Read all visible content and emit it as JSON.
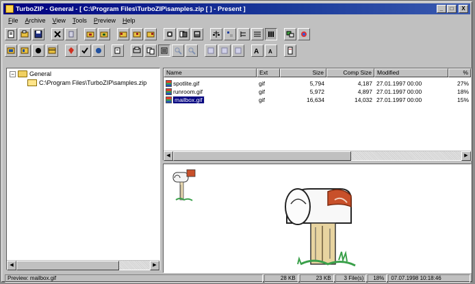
{
  "window": {
    "title": "TurboZIP - General - [ C:\\Program Files\\TurboZIP\\samples.zip [  ] - Present ]",
    "controls": [
      "_",
      "□",
      "X"
    ]
  },
  "menu": [
    {
      "u": "F",
      "rest": "ile"
    },
    {
      "u": "A",
      "rest": "rchive"
    },
    {
      "u": "V",
      "rest": "iew"
    },
    {
      "u": "T",
      "rest": "ools"
    },
    {
      "u": "P",
      "rest": "review"
    },
    {
      "u": "H",
      "rest": "elp"
    }
  ],
  "toolbar_icons": {
    "row1": [
      "new-icon",
      "open-icon",
      "save-icon",
      "delete-icon",
      "cut-icon",
      "add-icon",
      "extract-icon",
      "folder-view-icon",
      "folder-open-icon",
      "folder-close-icon",
      "view-icon",
      "zoom-icon",
      "print-icon",
      "scales-icon",
      "sort-icon",
      "tree-view-icon",
      "details-view-icon",
      "list-view-icon",
      "filter-icon",
      "options-icon"
    ],
    "row2": [
      "window-icon",
      "find-icon",
      "record-icon",
      "calendar-icon",
      "tag-icon",
      "check-icon",
      "test-icon",
      "copy-icon",
      "print-preview-icon",
      "preview-toggle-icon",
      "fit-icon",
      "zoom-in-icon",
      "zoom-out-icon",
      "tile-icon",
      "cascade-icon",
      "font-larger-icon",
      "font-smaller-icon",
      "settings-icon"
    ]
  },
  "tree": {
    "root": "General",
    "child": "C:\\Program Files\\TurboZIP\\samples.zip"
  },
  "list": {
    "columns": [
      "Name",
      "Ext",
      "Size",
      "Comp Size",
      "Modified",
      "%"
    ],
    "rows": [
      {
        "name": "spotlite.gif",
        "ext": "gif",
        "size": "5,794",
        "comp": "4,187",
        "modified": "27.01.1997 00:00",
        "pct": "27%"
      },
      {
        "name": "runroom.gif",
        "ext": "gif",
        "size": "5,972",
        "comp": "4,897",
        "modified": "27.01.1997 00:00",
        "pct": "18%"
      },
      {
        "name": "mailbox.gif",
        "ext": "gif",
        "size": "16,634",
        "comp": "14,032",
        "modified": "27.01.1997 00:00",
        "pct": "15%"
      }
    ],
    "selected_index": 2
  },
  "status": {
    "preview": "Preview: mailbox.gif",
    "size1": "28 KB",
    "size2": "23 KB",
    "files": "3 File(s)",
    "ratio": "18%",
    "datetime": "07.07.1998  10:18:46"
  }
}
